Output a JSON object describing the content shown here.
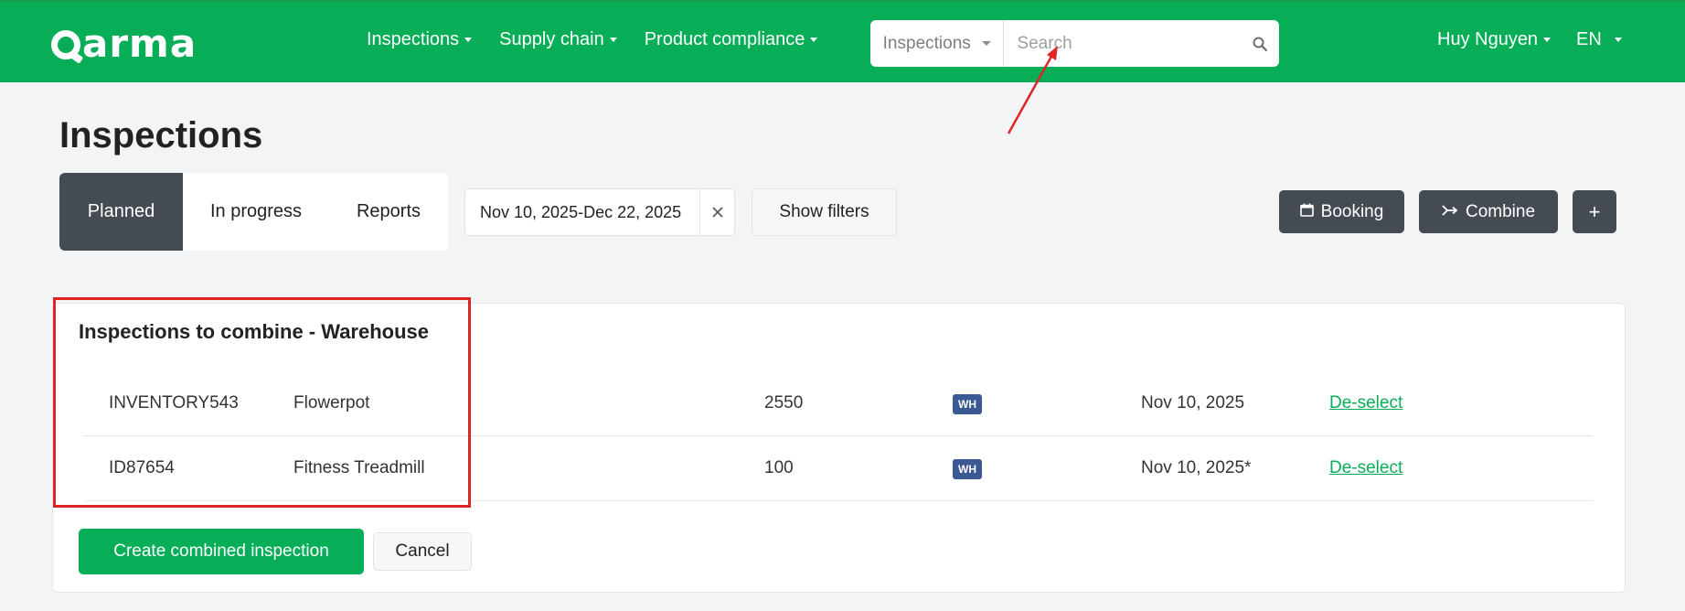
{
  "header": {
    "logo": "Qarma",
    "nav": [
      {
        "label": "Inspections"
      },
      {
        "label": "Supply chain"
      },
      {
        "label": "Product compliance"
      }
    ],
    "search": {
      "scope": "Inspections",
      "placeholder": "Search",
      "value": ""
    },
    "user": "Huy Nguyen",
    "language": "EN"
  },
  "page": {
    "title": "Inspections",
    "tabs": [
      {
        "label": "Planned",
        "active": true
      },
      {
        "label": "In progress",
        "active": false
      },
      {
        "label": "Reports",
        "active": false
      }
    ],
    "date_range": "Nov 10, 2025-Dec 22, 2025",
    "show_filters": "Show filters",
    "actions": {
      "booking": "Booking",
      "combine": "Combine",
      "add": "+"
    }
  },
  "combine_panel": {
    "title": "Inspections to combine - Warehouse",
    "rows": [
      {
        "id": "INVENTORY543",
        "name": "Flowerpot",
        "qty": "2550",
        "badge": "WH",
        "date": "Nov 10, 2025",
        "action": "De-select"
      },
      {
        "id": "ID87654",
        "name": "Fitness Treadmill",
        "qty": "100",
        "badge": "WH",
        "date": "Nov 10, 2025*",
        "action": "De-select"
      }
    ],
    "create_label": "Create combined inspection",
    "cancel_label": "Cancel"
  },
  "colors": {
    "brand_green": "#07ad57",
    "dark_button": "#454b53",
    "badge_blue": "#3b5a94",
    "annotation_red": "#e02424"
  }
}
